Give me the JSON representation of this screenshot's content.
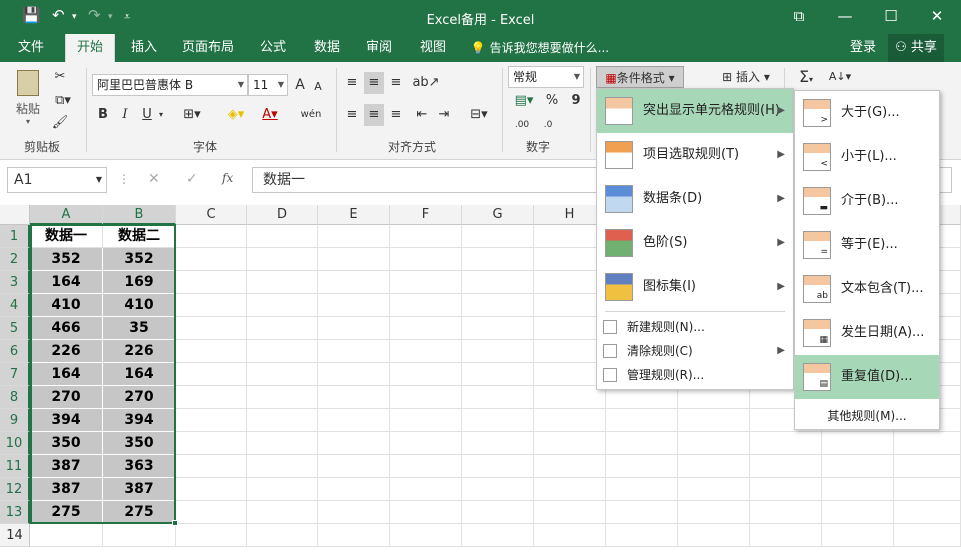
{
  "titlebar": {
    "title": "Excel备用 - Excel",
    "save_icon": "💾",
    "undo": "↶",
    "redo": "↷",
    "restore": "⧉",
    "minimize": "—",
    "maximize": "☐",
    "close": "✕"
  },
  "tabs": {
    "file": "文件",
    "home": "开始",
    "insert": "插入",
    "layout": "页面布局",
    "formulas": "公式",
    "data": "数据",
    "review": "审阅",
    "view": "视图",
    "tell": "告诉我您想要做什么...",
    "login": "登录",
    "share": "共享"
  },
  "ribbon": {
    "paste": "粘贴",
    "clipboard": "剪贴板",
    "font_name": "阿里巴巴普惠体 B",
    "font_size": "11",
    "font_group": "字体",
    "grow": "A",
    "shrink": "A",
    "bold": "B",
    "italic": "I",
    "underline": "U",
    "wen": "wén",
    "align_group": "对齐方式",
    "number_format": "常规",
    "number_group": "数字",
    "percent": "%",
    "comma": "9",
    "dec_inc": ".00",
    "dec_dec": ".0",
    "cond_format": "条件格式",
    "insert": "插入",
    "sigma": "Σ"
  },
  "formula": {
    "namebox": "A1",
    "fx": "fx",
    "content": "数据一",
    "cancel": "✕",
    "enter": "✓"
  },
  "columns": [
    "A",
    "B",
    "C",
    "D",
    "E",
    "F",
    "G",
    "H"
  ],
  "rows": [
    "1",
    "2",
    "3",
    "4",
    "5",
    "6",
    "7",
    "8",
    "9",
    "10",
    "11",
    "12",
    "13",
    "14"
  ],
  "table": {
    "headers": [
      "数据一",
      "数据二"
    ],
    "data": [
      [
        "352",
        "352"
      ],
      [
        "164",
        "169"
      ],
      [
        "410",
        "410"
      ],
      [
        "466",
        "35"
      ],
      [
        "226",
        "226"
      ],
      [
        "164",
        "164"
      ],
      [
        "270",
        "270"
      ],
      [
        "394",
        "394"
      ],
      [
        "350",
        "350"
      ],
      [
        "387",
        "363"
      ],
      [
        "387",
        "387"
      ],
      [
        "275",
        "275"
      ]
    ]
  },
  "menu_main": {
    "items": [
      {
        "label": "突出显示单元格规则(H)",
        "key": "H"
      },
      {
        "label": "项目选取规则(T)",
        "key": "T"
      },
      {
        "label": "数据条(D)",
        "key": "D"
      },
      {
        "label": "色阶(S)",
        "key": "S"
      },
      {
        "label": "图标集(I)",
        "key": "I"
      }
    ],
    "small": [
      {
        "label": "新建规则(N)..."
      },
      {
        "label": "清除规则(C)"
      },
      {
        "label": "管理规则(R)..."
      }
    ]
  },
  "menu_sub": {
    "items": [
      {
        "label": "大于(G)..."
      },
      {
        "label": "小于(L)..."
      },
      {
        "label": "介于(B)..."
      },
      {
        "label": "等于(E)..."
      },
      {
        "label": "文本包含(T)..."
      },
      {
        "label": "发生日期(A)..."
      },
      {
        "label": "重复值(D)..."
      }
    ],
    "more": "其他规则(M)..."
  },
  "colors": {
    "brand": "#217346",
    "highlight": "#a6d7b7",
    "selection": "#c6c6c6"
  }
}
